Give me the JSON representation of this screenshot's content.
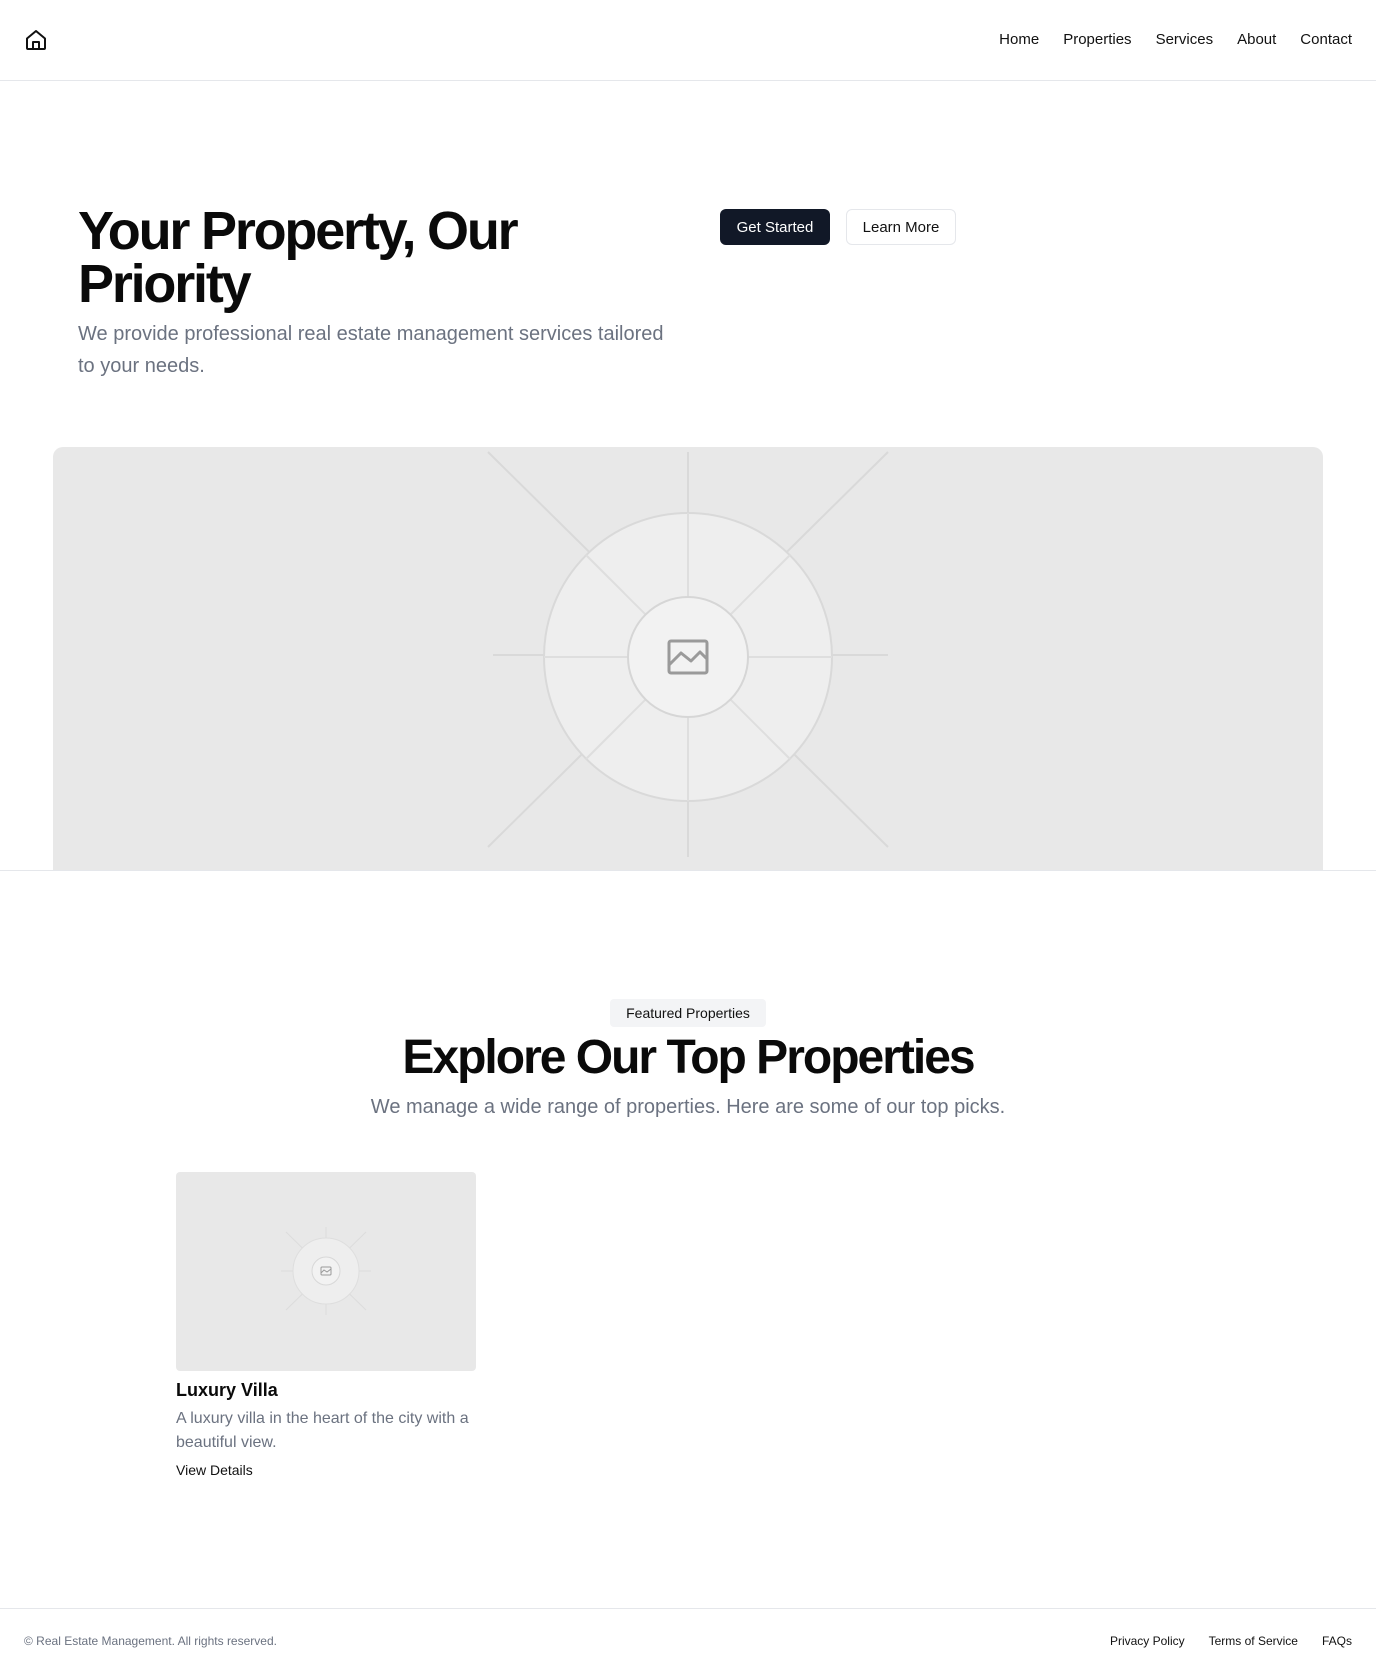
{
  "header": {
    "logo_icon": "home-icon",
    "nav": [
      "Home",
      "Properties",
      "Services",
      "About",
      "Contact"
    ]
  },
  "hero": {
    "title": "Your Property, Our Priority",
    "subtitle": "We provide professional real estate management services tailored to your needs.",
    "primary_button": "Get Started",
    "secondary_button": "Learn More",
    "image_icon": "image-placeholder-icon"
  },
  "featured": {
    "badge": "Featured Properties",
    "title": "Explore Our Top Properties",
    "subtitle": "We manage a wide range of properties. Here are some of our top picks.",
    "cards": [
      {
        "title": "Luxury Villa",
        "description": "A luxury villa in the heart of the city with a beautiful view.",
        "link": "View Details",
        "image_icon": "image-placeholder-icon"
      }
    ]
  },
  "footer": {
    "copyright": "© Real Estate Management. All rights reserved.",
    "links": [
      "Privacy Policy",
      "Terms of Service",
      "FAQs"
    ]
  },
  "colors": {
    "primary": "#111827",
    "muted_text": "#6b7280",
    "placeholder_bg": "#e8e8e8",
    "border": "#e5e7eb"
  }
}
